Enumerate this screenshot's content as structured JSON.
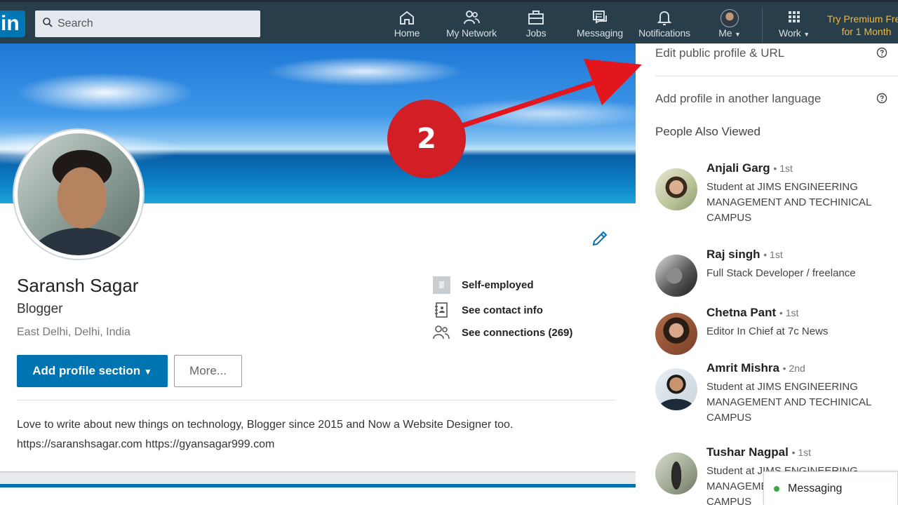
{
  "nav": {
    "logo": "in",
    "search_placeholder": "Search",
    "items": [
      {
        "label": "Home"
      },
      {
        "label": "My Network"
      },
      {
        "label": "Jobs"
      },
      {
        "label": "Messaging"
      },
      {
        "label": "Notifications"
      },
      {
        "label": "Me"
      },
      {
        "label": "Work"
      }
    ],
    "premium_line1": "Try Premium Free",
    "premium_line2": "for 1 Month"
  },
  "profile": {
    "name": "Saransh Sagar",
    "headline": "Blogger",
    "location": "East Delhi, Delhi, India",
    "add_section_label": "Add profile section",
    "more_label": "More...",
    "company": "Self-employed",
    "contact_info": "See contact info",
    "connections": "See connections (269)",
    "about_line1": "Love to write about new things on technology, Blogger since 2015 and Now a Website Designer too.",
    "about_line2": "https://saranshsagar.com https://gyansagar999.com"
  },
  "sidebar": {
    "edit_public_profile": "Edit public profile & URL",
    "add_language": "Add profile in another language",
    "people_also_viewed": "People Also Viewed",
    "people": [
      {
        "name": "Anjali Garg",
        "degree": "• 1st",
        "title": "Student at JIMS ENGINEERING MANAGEMENT AND TECHINICAL CAMPUS"
      },
      {
        "name": "Raj singh",
        "degree": "• 1st",
        "title": "Full Stack Developer / freelance"
      },
      {
        "name": "Chetna Pant",
        "degree": "• 1st",
        "title": "Editor In Chief at 7c News"
      },
      {
        "name": "Amrit Mishra",
        "degree": "• 2nd",
        "title": "Student at JIMS ENGINEERING MANAGEMENT AND TECHINICAL CAMPUS"
      },
      {
        "name": "Tushar Nagpal",
        "degree": "• 1st",
        "title": "Student at JIMS ENGINEERING MANAGEMENT AND TECHINICAL CAMPUS"
      }
    ]
  },
  "messaging_tab": "Messaging",
  "annotation": {
    "number": "2",
    "color": "#d11f25"
  },
  "colors": {
    "nav_bg": "#283e4a",
    "primary": "#0073b1",
    "premium": "#f5b83d"
  },
  "icons": [
    "search-icon",
    "home-icon",
    "network-icon",
    "jobs-icon",
    "messaging-icon",
    "notifications-icon",
    "grid-icon",
    "pencil-icon",
    "help-icon",
    "contact-icon",
    "connections-icon"
  ]
}
